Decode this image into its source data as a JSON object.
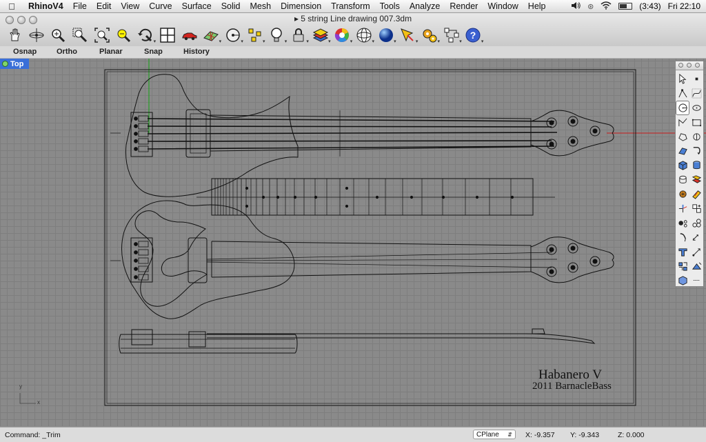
{
  "menubar": {
    "apple_icon": "apple-icon",
    "app_name": "RhinoV4",
    "items": [
      "File",
      "Edit",
      "View",
      "Curve",
      "Surface",
      "Solid",
      "Mesh",
      "Dimension",
      "Transform",
      "Tools",
      "Analyze",
      "Render",
      "Window",
      "Help"
    ],
    "battery_time": "(3:43)",
    "clock": "Fri 22:10"
  },
  "window": {
    "title": "5 string Line drawing 007.3dm"
  },
  "toolbar": {
    "icons": [
      "pan-icon",
      "rotate-view-icon",
      "zoom-dynamic-icon",
      "zoom-window-icon",
      "zoom-extents-icon",
      "zoom-selected-icon",
      "undo-view-icon",
      "four-viewports-icon",
      "car-render-icon",
      "grid-icon",
      "circle-center-icon",
      "points-icon",
      "lightbulb-icon",
      "lock-icon",
      "layers-icon",
      "color-wheel-icon",
      "sphere-icon",
      "render-sphere-icon",
      "paint-icon",
      "gear-icon",
      "grouping-icon",
      "help-icon"
    ]
  },
  "toggles": {
    "osnap": "Osnap",
    "ortho": "Ortho",
    "planar": "Planar",
    "snap": "Snap",
    "history": "History"
  },
  "viewport": {
    "name": "Top",
    "sheet_title": "Habanero V",
    "sheet_subtitle": "2011 BarnacleBass",
    "axis_y": "y",
    "axis_x": "x"
  },
  "palette": {
    "icons": [
      "select-arrow-icon",
      "point-icon",
      "polyline-icon",
      "curve-icon",
      "circle-icon",
      "ellipse-icon",
      "arc-icon",
      "rectangle-icon",
      "polygon-icon",
      "fillet-icon",
      "surface-icon",
      "revolve-icon",
      "box-icon",
      "cylinder-icon",
      "extrude-icon",
      "boolean-icon",
      "mesh-icon",
      "split-icon",
      "trim-icon",
      "join-icon",
      "explode-icon",
      "offset-icon",
      "text-icon",
      "dimension-icon",
      "array-icon",
      "move-icon",
      "mirror-icon",
      "scale-icon"
    ]
  },
  "status": {
    "command": "Command: _Trim",
    "cplane": "CPlane",
    "x": "X: -9.357",
    "y": "Y: -9.343",
    "z": "Z: 0.000"
  }
}
